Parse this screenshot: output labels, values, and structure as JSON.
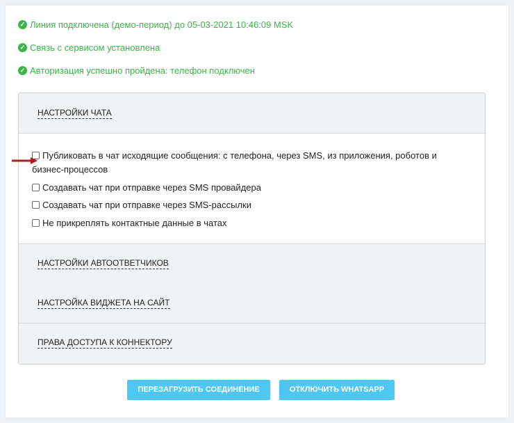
{
  "status": [
    {
      "icon": "check-circle-icon",
      "text": "Линия подключена (демо-период) до 05-03-2021 10:46:09 MSK"
    },
    {
      "icon": "check-circle-icon",
      "text": "Связь с сервисом установлена"
    },
    {
      "icon": "check-circle-icon",
      "text": "Авторизация успешно пройдена: телефон подключен"
    }
  ],
  "sections": {
    "chat": {
      "title": "Настройки чата",
      "options": [
        {
          "label": "Публиковать в чат исходящие сообщения: с телефона, через SMS, из приложения, роботов и бизнес-процессов",
          "checked": false
        },
        {
          "label": "Создавать чат при отправке через SMS провайдера",
          "checked": false
        },
        {
          "label": "Создавать чат при отправке через SMS-рассылки",
          "checked": false
        },
        {
          "label": "Не прикреплять контактные данные в чатах",
          "checked": false
        }
      ]
    },
    "autoresponders": {
      "title": "Настройки автоответчиков"
    },
    "widget": {
      "title": "Настройка виджета на сайт"
    },
    "access": {
      "title": "Права доступа к коннектору"
    }
  },
  "buttons": {
    "reload": "Перезагрузить соединение",
    "disable": "Отключить WhatsApp"
  },
  "colors": {
    "status_green": "#3cb54a",
    "button_blue": "#4fc7f3",
    "arrow_red": "#b21b1b"
  }
}
